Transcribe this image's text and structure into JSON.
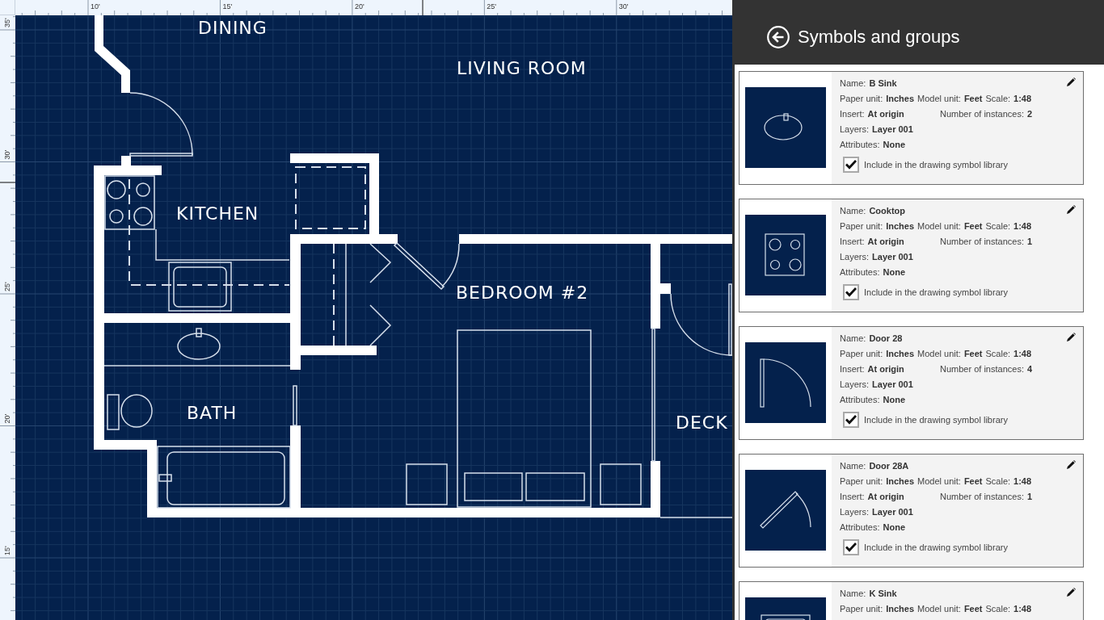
{
  "rulers": {
    "horizontal": [
      "10'",
      "15'",
      "20'",
      "25'",
      "30'"
    ],
    "vertical": [
      "35'",
      "30'",
      "25'",
      "20'",
      "15'"
    ]
  },
  "floor_plan": {
    "rooms": [
      "DINING",
      "LIVING ROOM",
      "KITCHEN",
      "BEDROOM #2",
      "BATH",
      "DECK"
    ]
  },
  "panel": {
    "title": "Symbols and groups",
    "symbols": [
      {
        "kind": "sink",
        "rows": [
          {
            "kind": "inline",
            "fields": [
              {
                "label": "Name:",
                "value": "B Sink"
              }
            ]
          },
          {
            "kind": "inline",
            "fields": [
              {
                "label": "Paper unit:",
                "value": "Inches"
              },
              {
                "label": "Model unit:",
                "value": "Feet"
              },
              {
                "label": "Scale:",
                "value": "1:48"
              }
            ]
          },
          {
            "kind": "columns",
            "fields": [
              {
                "label": "Insert:",
                "value": "At origin"
              },
              {
                "label": "Number of instances:",
                "value": "2"
              }
            ]
          },
          {
            "kind": "inline",
            "fields": [
              {
                "label": "Layers:",
                "value": "Layer 001"
              }
            ]
          },
          {
            "kind": "inline",
            "fields": [
              {
                "label": "Attributes:",
                "value": "None"
              }
            ]
          }
        ],
        "include": {
          "label": "Include in the drawing symbol library",
          "checked": true
        }
      },
      {
        "kind": "cooktop",
        "rows": [
          {
            "kind": "inline",
            "fields": [
              {
                "label": "Name:",
                "value": "Cooktop"
              }
            ]
          },
          {
            "kind": "inline",
            "fields": [
              {
                "label": "Paper unit:",
                "value": "Inches"
              },
              {
                "label": "Model unit:",
                "value": "Feet"
              },
              {
                "label": "Scale:",
                "value": "1:48"
              }
            ]
          },
          {
            "kind": "columns",
            "fields": [
              {
                "label": "Insert:",
                "value": "At origin"
              },
              {
                "label": "Number of instances:",
                "value": "1"
              }
            ]
          },
          {
            "kind": "inline",
            "fields": [
              {
                "label": "Layers:",
                "value": "Layer 001"
              }
            ]
          },
          {
            "kind": "inline",
            "fields": [
              {
                "label": "Attributes:",
                "value": "None"
              }
            ]
          }
        ],
        "include": {
          "label": "Include in the drawing symbol library",
          "checked": true
        }
      },
      {
        "kind": "door",
        "rows": [
          {
            "kind": "inline",
            "fields": [
              {
                "label": "Name:",
                "value": "Door 28"
              }
            ]
          },
          {
            "kind": "inline",
            "fields": [
              {
                "label": "Paper unit:",
                "value": "Inches"
              },
              {
                "label": "Model unit:",
                "value": "Feet"
              },
              {
                "label": "Scale:",
                "value": "1:48"
              }
            ]
          },
          {
            "kind": "columns",
            "fields": [
              {
                "label": "Insert:",
                "value": "At origin"
              },
              {
                "label": "Number of instances:",
                "value": "4"
              }
            ]
          },
          {
            "kind": "inline",
            "fields": [
              {
                "label": "Layers:",
                "value": "Layer 001"
              }
            ]
          },
          {
            "kind": "inline",
            "fields": [
              {
                "label": "Attributes:",
                "value": "None"
              }
            ]
          }
        ],
        "include": {
          "label": "Include in the drawing symbol library",
          "checked": true
        }
      },
      {
        "kind": "swing",
        "rows": [
          {
            "kind": "inline",
            "fields": [
              {
                "label": "Name:",
                "value": "Door 28A"
              }
            ]
          },
          {
            "kind": "inline",
            "fields": [
              {
                "label": "Paper unit:",
                "value": "Inches"
              },
              {
                "label": "Model unit:",
                "value": "Feet"
              },
              {
                "label": "Scale:",
                "value": "1:48"
              }
            ]
          },
          {
            "kind": "columns",
            "fields": [
              {
                "label": "Insert:",
                "value": "At origin"
              },
              {
                "label": "Number of instances:",
                "value": "1"
              }
            ]
          },
          {
            "kind": "inline",
            "fields": [
              {
                "label": "Layers:",
                "value": "Layer 001"
              }
            ]
          },
          {
            "kind": "inline",
            "fields": [
              {
                "label": "Attributes:",
                "value": "None"
              }
            ]
          }
        ],
        "include": {
          "label": "Include in the drawing symbol library",
          "checked": true
        }
      },
      {
        "kind": "basin",
        "rows": [
          {
            "kind": "inline",
            "fields": [
              {
                "label": "Name:",
                "value": "K Sink"
              }
            ]
          },
          {
            "kind": "inline",
            "fields": [
              {
                "label": "Paper unit:",
                "value": "Inches"
              },
              {
                "label": "Model unit:",
                "value": "Feet"
              },
              {
                "label": "Scale:",
                "value": "1:48"
              }
            ]
          }
        ]
      }
    ]
  }
}
